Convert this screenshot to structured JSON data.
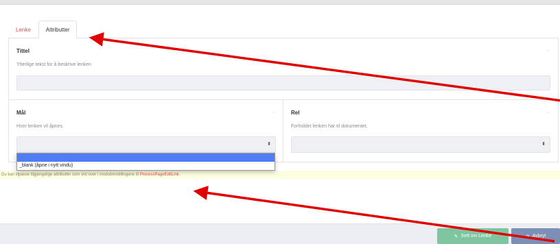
{
  "tabs": [
    {
      "label": "Lenke"
    },
    {
      "label": "Attributter"
    }
  ],
  "title_field": {
    "label": "Tittel",
    "description": "Ytterlige tekst for å beskrive lenken",
    "value": ""
  },
  "target_field": {
    "label": "Mål",
    "description": "Hvor lenken vil åpnes.",
    "selected": ""
  },
  "rel_field": {
    "label": "Rel",
    "description": "Forholdet lenken har til dokumentet.",
    "selected": ""
  },
  "dropdown": {
    "options": [
      "",
      "_blank (åpne i nytt vindu)"
    ]
  },
  "notice": {
    "text": "Du kan tilpasse tilgjengelige attributter som vist over i modulinnstillingene til ",
    "link": "ProcessPageEditLink",
    "suffix": "."
  },
  "footer": {
    "insert_label": "Sett inn Lenke",
    "cancel_label": "Avbryt"
  },
  "icons": {
    "collapse": "chevron-down-icon",
    "select": "sort-arrows-icon",
    "insert": "link-icon",
    "cancel": "cancel-icon"
  },
  "colors": {
    "tab_link": "#d9534f",
    "annotation_arrow": "#e00000",
    "insert_button": "#7dc6a0",
    "cancel_button": "#7c8fb4",
    "dropdown_highlight": "#4f7df5",
    "notice_bg": "#fdfde0"
  }
}
